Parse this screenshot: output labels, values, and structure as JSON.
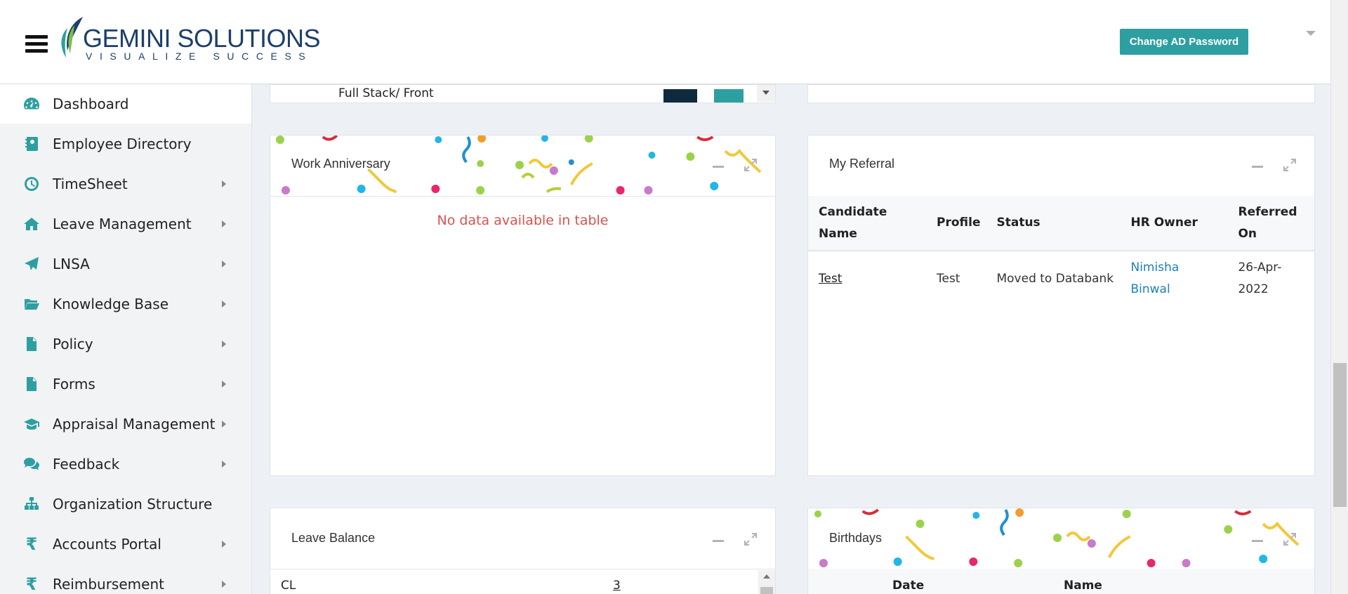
{
  "header": {
    "logo_main": "GEMINI SOLUTIONS",
    "logo_tagline": "VISUALIZE SUCCESS",
    "change_password_label": "Change AD Password"
  },
  "sidebar": {
    "items": [
      {
        "label": "Dashboard",
        "icon": "dashboard-icon",
        "has_submenu": false,
        "active": true
      },
      {
        "label": "Employee Directory",
        "icon": "contact-book-icon",
        "has_submenu": false
      },
      {
        "label": "TimeSheet",
        "icon": "clock-icon",
        "has_submenu": true
      },
      {
        "label": "Leave Management",
        "icon": "home-icon",
        "has_submenu": true
      },
      {
        "label": "LNSA",
        "icon": "paper-plane-icon",
        "has_submenu": true
      },
      {
        "label": "Knowledge Base",
        "icon": "folder-open-icon",
        "has_submenu": true
      },
      {
        "label": "Policy",
        "icon": "document-icon",
        "has_submenu": true
      },
      {
        "label": "Forms",
        "icon": "document-icon",
        "has_submenu": true
      },
      {
        "label": "Appraisal Management",
        "icon": "graduation-cap-icon",
        "has_submenu": true
      },
      {
        "label": "Feedback",
        "icon": "chat-bubbles-icon",
        "has_submenu": true
      },
      {
        "label": "Organization Structure",
        "icon": "sitemap-icon",
        "has_submenu": false
      },
      {
        "label": "Accounts Portal",
        "icon": "rupee-icon",
        "has_submenu": true
      },
      {
        "label": "Reimbursement",
        "icon": "rupee-icon",
        "has_submenu": true
      }
    ]
  },
  "top_strip": {
    "cell_1": "Full Stack/ Front"
  },
  "work_anniversary": {
    "title": "Work Anniversary",
    "empty_message": "No data available in table"
  },
  "my_referral": {
    "title": "My Referral",
    "columns": [
      "Candidate Name",
      "Profile",
      "Status",
      "HR Owner",
      "Referred On"
    ],
    "rows": [
      {
        "candidate": "Test",
        "profile": "Test",
        "status": "Moved to Databank",
        "hr_owner": "Nimisha Binwal",
        "referred_on": "26-Apr-2022"
      }
    ]
  },
  "leave_balance": {
    "title": "Leave Balance",
    "rows": [
      {
        "type": "CL",
        "value": "3"
      }
    ]
  },
  "birthdays": {
    "title": "Birthdays",
    "columns": [
      "Date",
      "Name"
    ]
  },
  "colors": {
    "accent": "#2e9fa1",
    "brand_navy": "#1d3f6a",
    "error": "#d9534f",
    "link": "#1e7fbf"
  }
}
